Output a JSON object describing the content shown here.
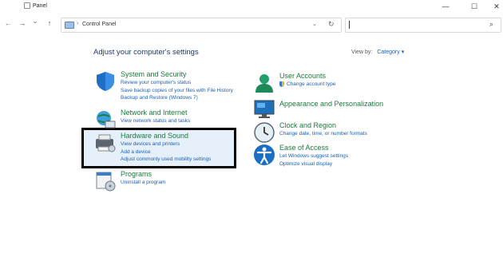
{
  "window": {
    "title": "Panel",
    "controls": {
      "minimize": "—",
      "maximize": "☐",
      "close": "✕"
    }
  },
  "nav": {
    "back": "←",
    "forward": "→",
    "recent": "⌄",
    "up": "↑"
  },
  "address": {
    "separator": "›",
    "path": "Control Panel",
    "dropdown": "⌄",
    "refresh": "↻"
  },
  "search": {
    "icon": "⌕",
    "value": ""
  },
  "main": {
    "heading": "Adjust your computer's settings",
    "view_by": {
      "label": "View by:",
      "value": "Category ▾"
    }
  },
  "categories_left": [
    {
      "title": "System and Security",
      "links": [
        "Review your computer's status",
        "Save backup copies of your files with File History",
        "Backup and Restore (Windows 7)"
      ]
    },
    {
      "title": "Network and Internet",
      "links": [
        "View network status and tasks"
      ]
    },
    {
      "title": "Hardware and Sound",
      "links": [
        "View devices and printers",
        "Add a device",
        "Adjust commonly used mobility settings"
      ]
    },
    {
      "title": "Programs",
      "links": [
        "Uninstall a program"
      ]
    }
  ],
  "categories_right": [
    {
      "title": "User Accounts",
      "links": [
        "Change account type"
      ]
    },
    {
      "title": "Appearance and Personalization",
      "links": []
    },
    {
      "title": "Clock and Region",
      "links": [
        "Change date, time, or number formats"
      ]
    },
    {
      "title": "Ease of Access",
      "links": [
        "Let Windows suggest settings",
        "Optimize visual display"
      ]
    }
  ],
  "colors": {
    "title_green": "#1b7a3d",
    "link_blue": "#1a5fb4",
    "heading": "#1e3a6b"
  }
}
